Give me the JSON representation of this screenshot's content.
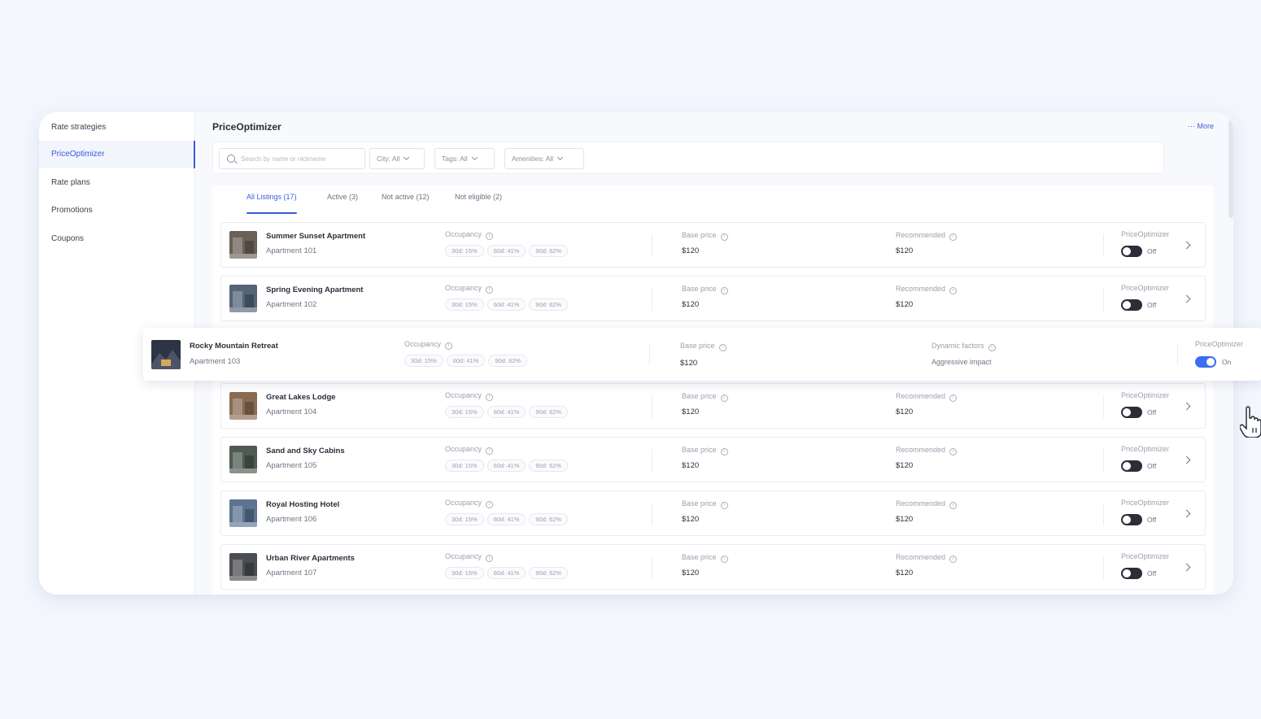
{
  "sidebar": {
    "items": [
      {
        "label": "Rate strategies",
        "active": false
      },
      {
        "label": "PriceOptimizer",
        "active": true
      },
      {
        "label": "Rate plans",
        "active": false
      },
      {
        "label": "Promotions",
        "active": false
      },
      {
        "label": "Coupons",
        "active": false
      }
    ]
  },
  "header": {
    "title": "PriceOptimizer",
    "more_label": "··· More"
  },
  "filters": {
    "search_placeholder": "Search by name or nickname",
    "city": "City: All",
    "tags": "Tags: All",
    "amenities": "Amenities: All"
  },
  "tabs": [
    {
      "label": "All Listings (17)",
      "active": true
    },
    {
      "label": "Active (3)",
      "active": false
    },
    {
      "label": "Not active (12)",
      "active": false
    },
    {
      "label": "Not eligible (2)",
      "active": false
    }
  ],
  "columns": {
    "occupancy": "Occupancy",
    "base_price": "Base price",
    "recommended": "Recommended",
    "dynamic_factors": "Dynamic factors",
    "price_optimizer": "PriceOptimizer"
  },
  "listings": [
    {
      "name": "Summer Sunset Apartment",
      "apt": "Apartment 101",
      "occ": [
        "30d: 15%",
        "60d: 41%",
        "90d: 62%"
      ],
      "base": "$120",
      "recommended": "$120",
      "toggle": "Off",
      "thumb": "#6b6157"
    },
    {
      "name": "Spring Evening Apartment",
      "apt": "Apartment 102",
      "occ": [
        "30d: 15%",
        "60d: 41%",
        "90d: 62%"
      ],
      "base": "$120",
      "recommended": "$120",
      "toggle": "Off",
      "thumb": "#556577"
    },
    {
      "name": "Great Lakes Lodge",
      "apt": "Apartment 104",
      "occ": [
        "30d: 15%",
        "60d: 41%",
        "90d: 62%"
      ],
      "base": "$120",
      "recommended": "$120",
      "toggle": "Off",
      "thumb": "#8a6b52"
    },
    {
      "name": "Sand and Sky Cabins",
      "apt": "Apartment 105",
      "occ": [
        "30d: 15%",
        "60d: 41%",
        "90d: 62%"
      ],
      "base": "$120",
      "recommended": "$120",
      "toggle": "Off",
      "thumb": "#4f5a52"
    },
    {
      "name": "Royal Hosting Hotel",
      "apt": "Apartment 106",
      "occ": [
        "30d: 15%",
        "60d: 41%",
        "90d: 62%"
      ],
      "base": "$120",
      "recommended": "$120",
      "toggle": "Off",
      "thumb": "#5d7390"
    },
    {
      "name": "Urban River Apartments",
      "apt": "Apartment 107",
      "occ": [
        "30d: 15%",
        "60d: 41%",
        "90d: 62%"
      ],
      "base": "$120",
      "recommended": "$120",
      "toggle": "Off",
      "thumb": "#4a4d52"
    }
  ],
  "floating_listing": {
    "name": "Rocky Mountain Retreat",
    "apt": "Apartment 103",
    "occ": [
      "30d: 15%",
      "60d: 41%",
      "90d: 62%"
    ],
    "base": "$120",
    "dynamic_value": "Aggressive impact",
    "toggle": "On",
    "thumb": "#2c3445"
  },
  "colors": {
    "accent": "#3b5bdb",
    "toggle_on": "#3b6ef0",
    "toggle_off": "#2b2e36",
    "background": "#f3f6fd"
  }
}
